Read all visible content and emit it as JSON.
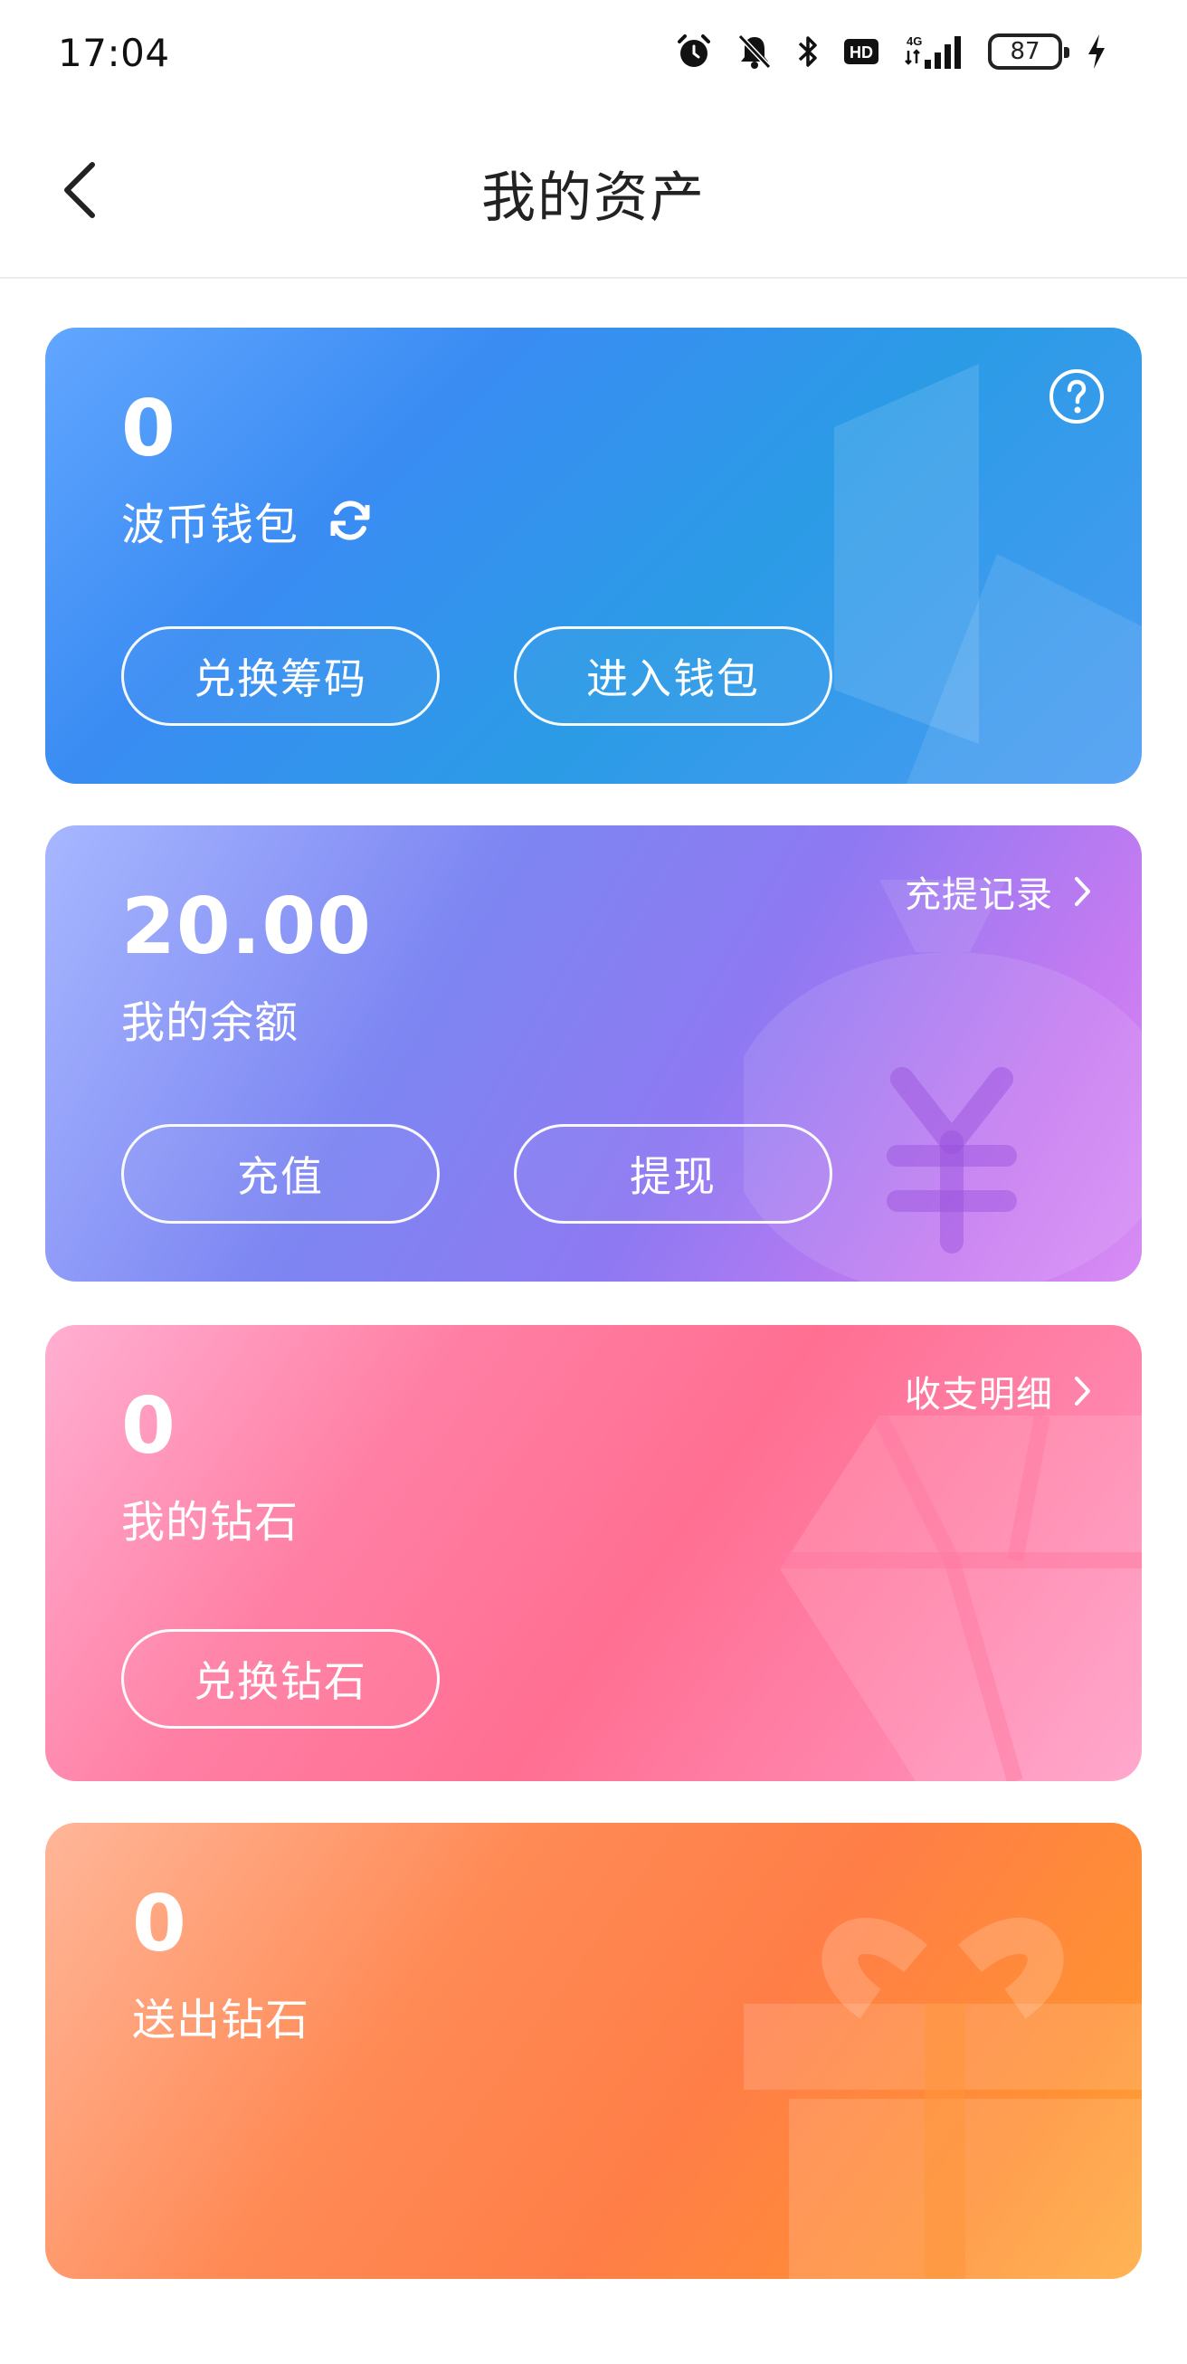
{
  "status_bar": {
    "time": "17:04",
    "icons": [
      "alarm-icon",
      "mute-bell-icon",
      "bluetooth-icon",
      "hd-icon",
      "4g-signal-icon",
      "battery-icon",
      "charging-icon"
    ],
    "battery_level": "87"
  },
  "header": {
    "title": "我的资产",
    "back_icon": "chevron-left-icon"
  },
  "wallet_card": {
    "amount": "0",
    "label": "波币钱包",
    "refresh_icon": "refresh-icon",
    "help_icon": "help-circle-icon",
    "exchange_label": "兑换筹码",
    "enter_label": "进入钱包"
  },
  "balance_card": {
    "amount": "20.00",
    "label": "我的余额",
    "records_link": "充提记录",
    "recharge_label": "充值",
    "withdraw_label": "提现"
  },
  "diamond_card": {
    "amount": "0",
    "label": "我的钻石",
    "details_link": "收支明细",
    "exchange_label": "兑换钻石"
  },
  "sent_card": {
    "amount": "0",
    "label": "送出钻石"
  },
  "colors": {
    "wallet": "#3a8cf3",
    "balance": "#8e79f2",
    "diamond": "#ff6f92",
    "sent": "#ff8a55"
  }
}
